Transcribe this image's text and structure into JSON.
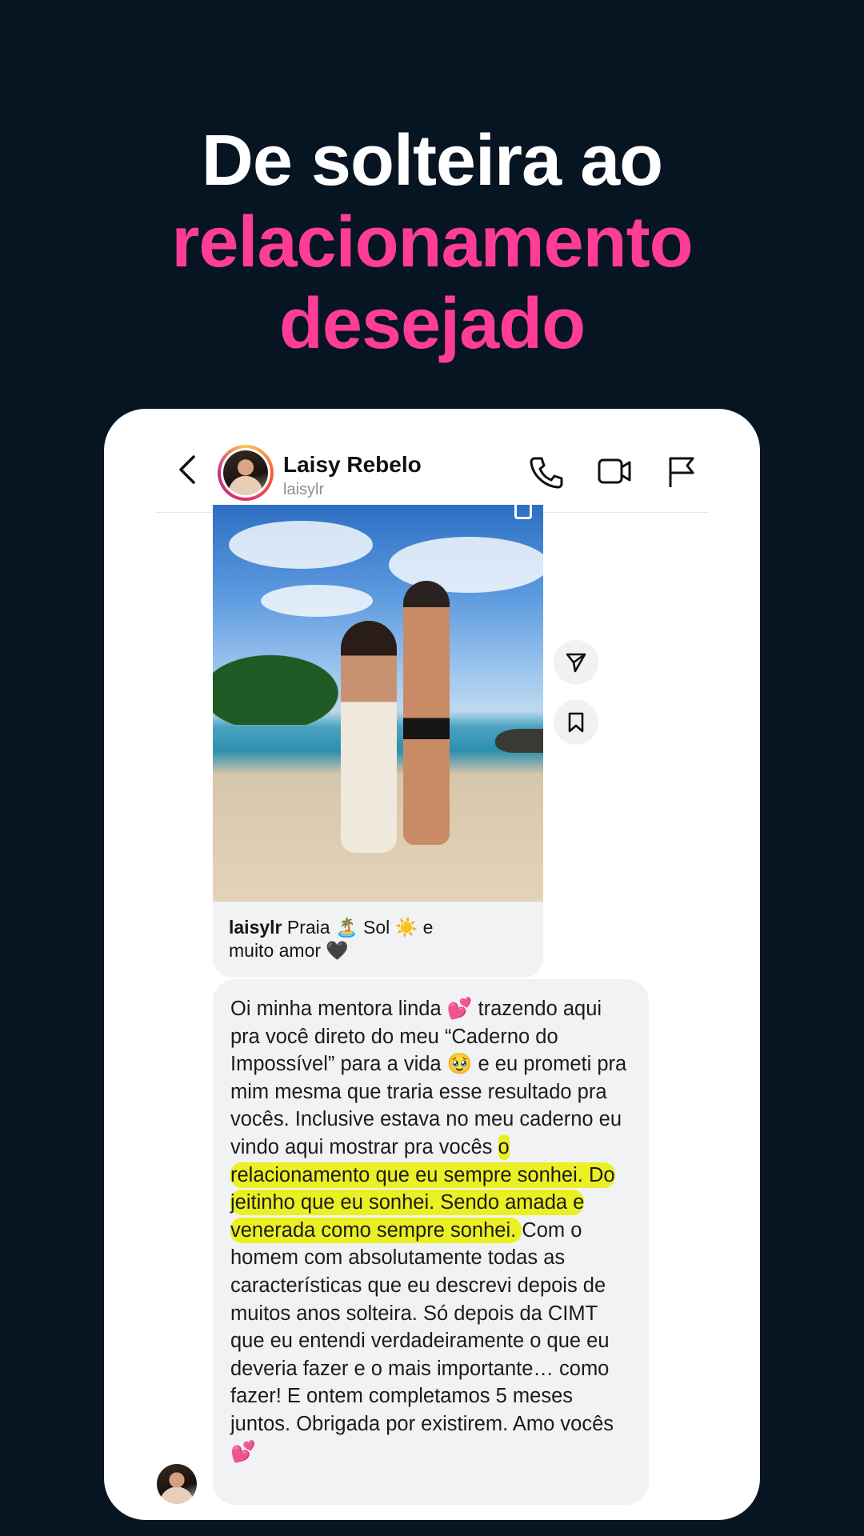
{
  "headline": {
    "line1": "De solteira ao",
    "line2": "relacionamento",
    "line3": "desejado",
    "colors": {
      "white": "#ffffff",
      "pink": "#ff3d98",
      "background": "#071523"
    }
  },
  "chat_header": {
    "name": "Laisy Rebelo",
    "handle": "laisylr",
    "icons": [
      "chevron-left-icon",
      "phone-icon",
      "video-icon",
      "flag-icon"
    ]
  },
  "post": {
    "caption_user": "laisylr",
    "caption_text_1": " Praia 🏝️ Sol ☀️ e",
    "caption_text_2": "muito amor 🖤",
    "side_icons": [
      "send-icon",
      "bookmark-icon"
    ]
  },
  "message": {
    "part1": "Oi minha mentora linda 💕 trazendo aqui pra você direto do meu “Caderno do Impossível” para a vida 🥹 e eu prometi pra mim mesma que traria esse resultado pra vocês. Inclusive estava no meu caderno eu vindo aqui mostrar pra vocês ",
    "highlight": "o relacionamento que eu sempre sonhei. Do jeitinho que eu sonhei. Sendo amada e venerada como sempre sonhei. ",
    "part2": "Com o homem com absolutamente todas as características que eu descrevi depois de muitos anos solteira. Só depois da CIMT que eu entendi verdadeiramente o que eu deveria fazer e o mais importante… como fazer! E ontem completamos 5 meses juntos. Obrigada por existirem. Amo vocês 💕",
    "highlight_color": "#eaf023"
  }
}
